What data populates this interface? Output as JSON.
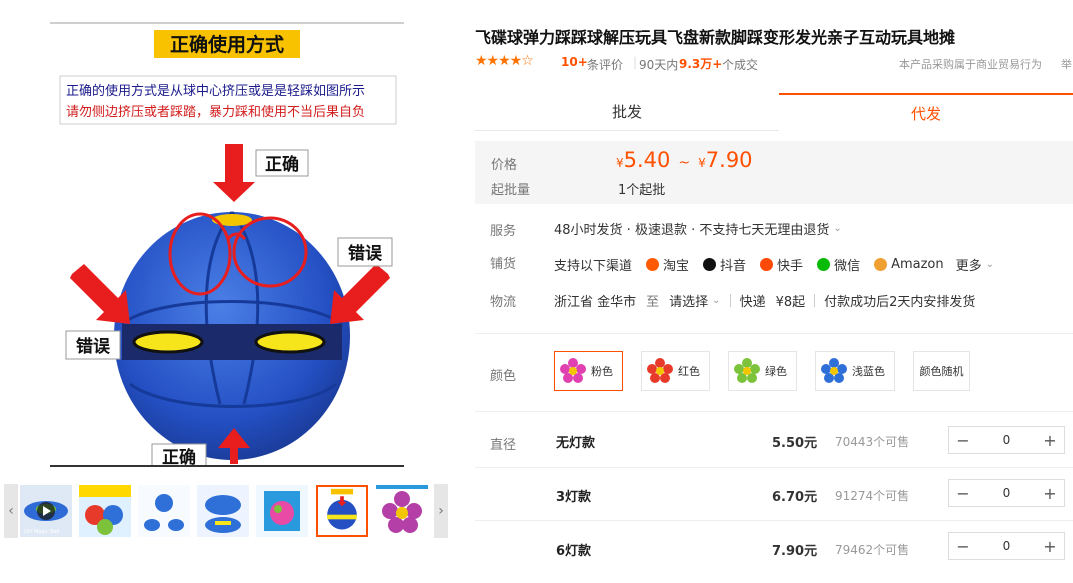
{
  "gallery": {
    "main_image": {
      "banner": "正确使用方式",
      "instruction_line1": "正确的使用方式是从球中心挤压或是是轻踩如图所示",
      "instruction_line2": "请勿侧边挤压或者踩踏，暴力踩和使用不当后果自负",
      "label_correct_top": "正确",
      "label_wrong_right": "错误",
      "label_wrong_left": "错误",
      "label_correct_bottom": "正确"
    },
    "thumb_prev": "‹",
    "thumb_next": "›",
    "thumbnails": [
      {
        "alt": "DIY Magic Ball"
      },
      {
        "alt": "魔幻飞碟变形球"
      },
      {
        "alt": "ball-variants"
      },
      {
        "alt": "ball-stomp"
      },
      {
        "alt": "ball-box"
      },
      {
        "alt": "正确使用方式",
        "active": true
      },
      {
        "alt": "pink-flower"
      }
    ]
  },
  "product": {
    "title": "飞碟球弹力踩踩球解压玩具飞盘新款脚踩变形发光亲子互动玩具地摊",
    "stars": "★★★★☆",
    "review_count": "10+",
    "review_unit": "条评价",
    "sep": "|",
    "period": "90天内",
    "sold": "9.3万+",
    "sold_unit": "个成交",
    "note": "本产品采购属于商业贸易行为",
    "note2": "举"
  },
  "tabs": [
    {
      "label": "批发",
      "active": false
    },
    {
      "label": "代发",
      "active": true
    }
  ],
  "price": {
    "label": "价格",
    "currency": "¥",
    "min": "5.40",
    "tilde": "~",
    "max": "7.90",
    "moq_label": "起批量",
    "moq_value": "1个起批"
  },
  "service": {
    "label": "服务",
    "value": "48小时发货 · 极速退款 · 不支持七天无理由退货",
    "chev": "⌄"
  },
  "distribution": {
    "label": "铺货",
    "intro": "支持以下渠道",
    "channels": [
      {
        "name": "淘宝",
        "color": "#ff5a00"
      },
      {
        "name": "抖音",
        "color": "#111111"
      },
      {
        "name": "快手",
        "color": "#ff4906"
      },
      {
        "name": "微信",
        "color": "#09bb07"
      },
      {
        "name": "Amazon",
        "color": "#f0a030"
      }
    ],
    "more": "更多",
    "chev": "⌄"
  },
  "logistics": {
    "label": "物流",
    "origin": "浙江省 金华市",
    "to": "至",
    "select": "请选择",
    "chev": "⌄",
    "express": "快递",
    "fee": "¥8起",
    "dispatch": "付款成功后2天内安排发货"
  },
  "color": {
    "label": "颜色",
    "options": [
      {
        "name": "粉色",
        "color": "#e040b0",
        "active": true
      },
      {
        "name": "红色",
        "color": "#e83a2a",
        "active": false
      },
      {
        "name": "绿色",
        "color": "#7cc23a",
        "active": false
      },
      {
        "name": "浅蓝色",
        "color": "#2e6fd8",
        "active": false
      },
      {
        "name": "颜色随机",
        "color": "",
        "active": false
      }
    ]
  },
  "diameter": {
    "label": "直径",
    "skus": [
      {
        "name": "无灯款",
        "price": "5.50元",
        "stock": "70443个可售",
        "qty": "0"
      },
      {
        "name": "3灯款",
        "price": "6.70元",
        "stock": "91274个可售",
        "qty": "0"
      },
      {
        "name": "6灯款",
        "price": "7.90元",
        "stock": "79462个可售",
        "qty": "0"
      }
    ],
    "minus": "−",
    "plus": "+"
  }
}
